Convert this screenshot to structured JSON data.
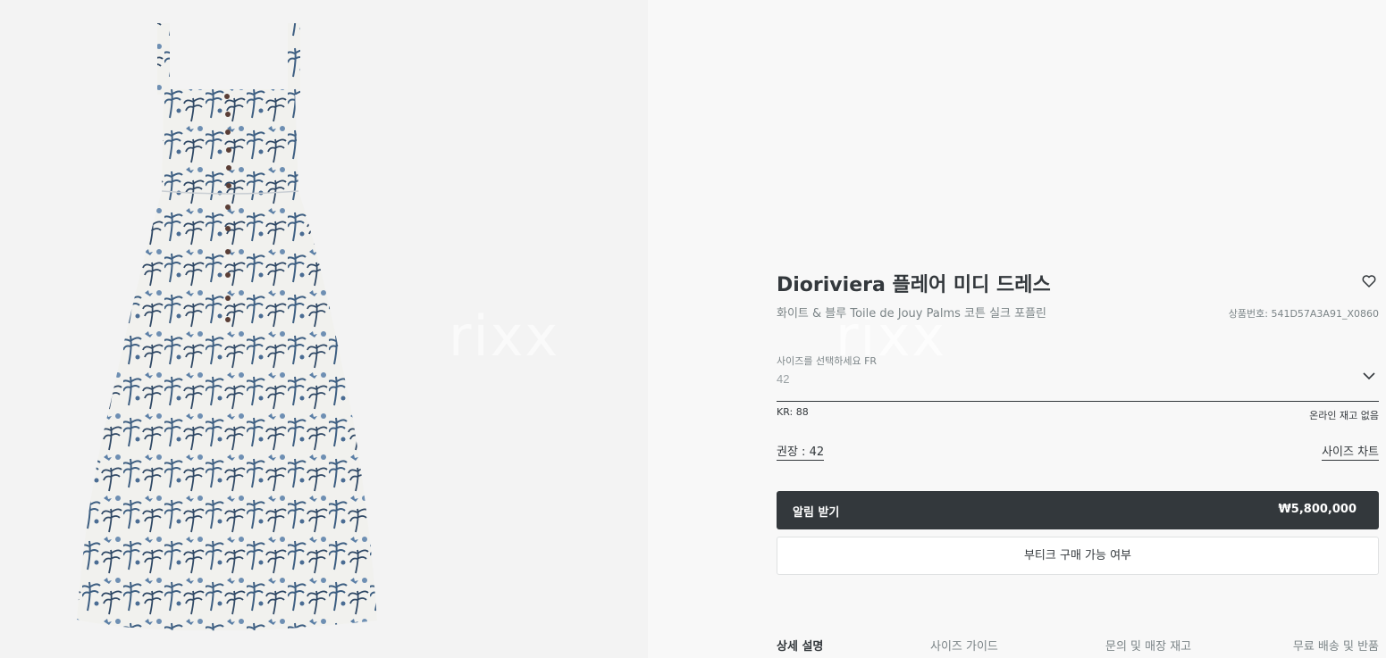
{
  "product": {
    "title": "Dioriviera 플레어 미디 드레스",
    "subtitle": "화이트 & 블루 Toile de Jouy Palms 코튼 실크 포플린",
    "sku": "상품번호: 541D57A3A91_X0860",
    "image_alt": "dress-product-image",
    "watermark": "rixx"
  },
  "size": {
    "label": "사이즈를 선택하세요 FR",
    "value": "42",
    "kr_size": "KR: 88",
    "stock_status": "온라인 재고 없음",
    "recommended": "권장 : 42",
    "chart_link": "사이즈 차트"
  },
  "actions": {
    "notify_label": "알림 받기",
    "price": "₩5,800,000",
    "boutique_label": "부티크 구매 가능 여부"
  },
  "tabs": [
    {
      "label": "상세 설명",
      "active": true
    },
    {
      "label": "사이즈 가이드",
      "active": false
    },
    {
      "label": "문의 및 매장 재고",
      "active": false
    },
    {
      "label": "무료 배송 및 반품",
      "active": false
    }
  ],
  "icons": {
    "favorite": "heart-outline-icon",
    "dropdown": "chevron-down-icon"
  },
  "colors": {
    "primary_button": "#33383c",
    "page_background": "#f8f8f8",
    "gallery_background": "#f3f3f3",
    "print_blue": "#3e5f82"
  }
}
